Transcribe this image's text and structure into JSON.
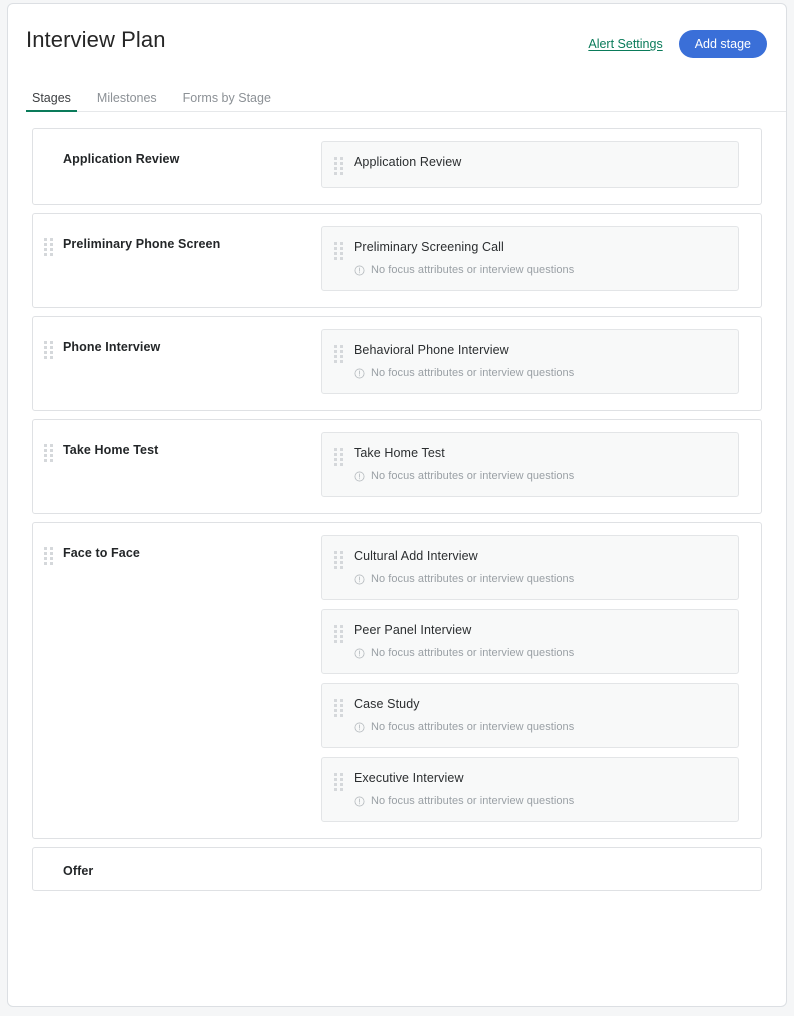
{
  "header": {
    "title": "Interview Plan",
    "alert_settings_label": "Alert Settings",
    "add_stage_label": "Add stage",
    "link_color": "#0a7b5a",
    "button_color": "#3a6fd8"
  },
  "tabs": [
    {
      "label": "Stages",
      "active": true
    },
    {
      "label": "Milestones",
      "active": false
    },
    {
      "label": "Forms by Stage",
      "active": false
    }
  ],
  "active_tab_indicator_color": "#0a7b5a",
  "no_attributes_text": "No focus attributes or interview questions",
  "stages": [
    {
      "name": "Application Review",
      "draggable": false,
      "items": [
        {
          "title": "Application Review",
          "meta": null
        }
      ]
    },
    {
      "name": "Preliminary Phone Screen",
      "draggable": true,
      "items": [
        {
          "title": "Preliminary Screening Call",
          "meta": "No focus attributes or interview questions"
        }
      ]
    },
    {
      "name": "Phone Interview",
      "draggable": true,
      "items": [
        {
          "title": "Behavioral Phone Interview",
          "meta": "No focus attributes or interview questions"
        }
      ]
    },
    {
      "name": "Take Home Test",
      "draggable": true,
      "items": [
        {
          "title": "Take Home Test",
          "meta": "No focus attributes or interview questions"
        }
      ]
    },
    {
      "name": "Face to Face",
      "draggable": true,
      "items": [
        {
          "title": "Cultural Add Interview",
          "meta": "No focus attributes or interview questions"
        },
        {
          "title": "Peer Panel Interview",
          "meta": "No focus attributes or interview questions"
        },
        {
          "title": "Case Study",
          "meta": "No focus attributes or interview questions"
        },
        {
          "title": "Executive Interview",
          "meta": "No focus attributes or interview questions"
        }
      ]
    },
    {
      "name": "Offer",
      "draggable": false,
      "items": []
    }
  ]
}
